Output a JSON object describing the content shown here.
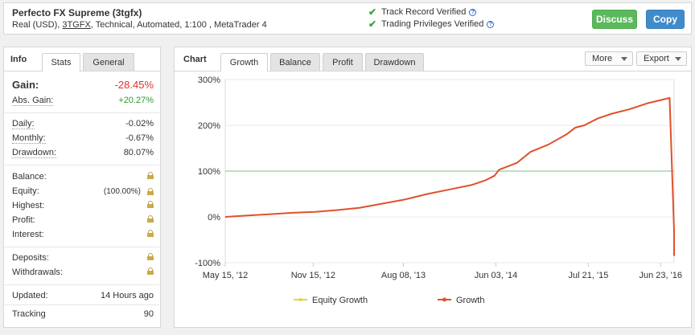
{
  "header": {
    "title": "Perfecto FX Supreme (3tgfx)",
    "sub_prefix": "Real (USD), ",
    "sub_link": "3TGFX",
    "sub_suffix": ", Technical, Automated, 1:100 , MetaTrader 4",
    "verify1": "Track Record Verified",
    "verify2": "Trading Privileges Verified",
    "discuss": "Discuss",
    "copy": "Copy"
  },
  "left": {
    "tab_info": "Info",
    "tab_stats": "Stats",
    "tab_general": "General",
    "gain_label": "Gain:",
    "gain_value": "-28.45%",
    "abs_gain_label": "Abs. Gain:",
    "abs_gain_value": "+20.27%",
    "daily_label": "Daily:",
    "daily_value": "-0.02%",
    "monthly_label": "Monthly:",
    "monthly_value": "-0.67%",
    "drawdown_label": "Drawdown:",
    "drawdown_value": "80.07%",
    "balance_label": "Balance:",
    "equity_label": "Equity:",
    "equity_pct": "(100.00%)",
    "highest_label": "Highest:",
    "profit_label": "Profit:",
    "interest_label": "Interest:",
    "deposits_label": "Deposits:",
    "withdrawals_label": "Withdrawals:",
    "updated_label": "Updated:",
    "updated_value": "14 Hours ago",
    "tracking_label": "Tracking",
    "tracking_value": "90"
  },
  "chart_panel": {
    "label": "Chart",
    "tabs": [
      "Growth",
      "Balance",
      "Profit",
      "Drawdown"
    ],
    "more": "More",
    "export": "Export"
  },
  "colors": {
    "growth": "#e0502e",
    "equity": "#e8d23a",
    "equity_line": "#7fc27f",
    "negative": "#e03030",
    "positive": "#2a9a2a"
  },
  "chart_data": {
    "type": "line",
    "ylim": [
      -100,
      300
    ],
    "yticks": [
      "300%",
      "200%",
      "100%",
      "0%",
      "-100%"
    ],
    "yvals": [
      300,
      200,
      100,
      0,
      -100
    ],
    "xticks": [
      "May 15, '12",
      "Nov 15, '12",
      "Aug 08, '13",
      "Jun 03, '14",
      "Jul 21, '15",
      "Jun 23, '16"
    ],
    "xtick_pos": [
      0,
      0.196,
      0.397,
      0.603,
      0.809,
      0.97
    ],
    "legend": [
      "Equity Growth",
      "Growth"
    ],
    "series": [
      {
        "name": "Growth",
        "points": [
          [
            0,
            0
          ],
          [
            0.05,
            3
          ],
          [
            0.1,
            6
          ],
          [
            0.15,
            9
          ],
          [
            0.2,
            11
          ],
          [
            0.25,
            15
          ],
          [
            0.3,
            20
          ],
          [
            0.35,
            29
          ],
          [
            0.4,
            38
          ],
          [
            0.45,
            50
          ],
          [
            0.5,
            60
          ],
          [
            0.55,
            70
          ],
          [
            0.58,
            80
          ],
          [
            0.6,
            90
          ],
          [
            0.61,
            103
          ],
          [
            0.65,
            118
          ],
          [
            0.68,
            142
          ],
          [
            0.72,
            158
          ],
          [
            0.76,
            180
          ],
          [
            0.78,
            195
          ],
          [
            0.8,
            200
          ],
          [
            0.83,
            215
          ],
          [
            0.86,
            225
          ],
          [
            0.9,
            235
          ],
          [
            0.94,
            248
          ],
          [
            0.97,
            255
          ],
          [
            0.99,
            260
          ],
          [
            1.0,
            -30
          ],
          [
            1.0,
            -85
          ]
        ]
      },
      {
        "name": "Equity Growth",
        "points": [
          [
            0,
            100
          ],
          [
            1.0,
            100
          ]
        ]
      }
    ]
  }
}
